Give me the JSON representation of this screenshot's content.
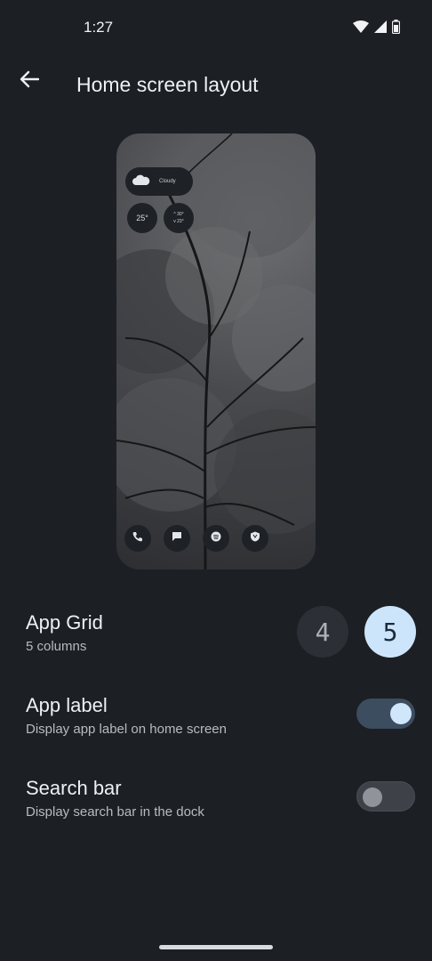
{
  "status_bar": {
    "time": "1:27",
    "icons": [
      "wifi-icon",
      "signal-icon",
      "battery-icon"
    ]
  },
  "app_bar": {
    "title": "Home screen layout",
    "back_icon": "arrow-back-icon"
  },
  "preview": {
    "weather_label": "Cloudy",
    "temperature": "25°",
    "high": "^ 30°",
    "low": "v 23°",
    "dock_icons": [
      "phone-icon",
      "messages-icon",
      "spotify-icon",
      "shield-app-icon"
    ]
  },
  "app_grid": {
    "title": "App Grid",
    "subtitle": "5 columns",
    "options": [
      "4",
      "5"
    ],
    "selected": "5"
  },
  "app_label": {
    "title": "App label",
    "subtitle": "Display app label on home screen",
    "enabled": true
  },
  "search_bar": {
    "title": "Search bar",
    "subtitle": "Display search bar in the dock",
    "enabled": false
  },
  "colors": {
    "background": "#1c1f23",
    "accent": "#cde5fb",
    "toggle_on_track": "#3b4d5e"
  }
}
